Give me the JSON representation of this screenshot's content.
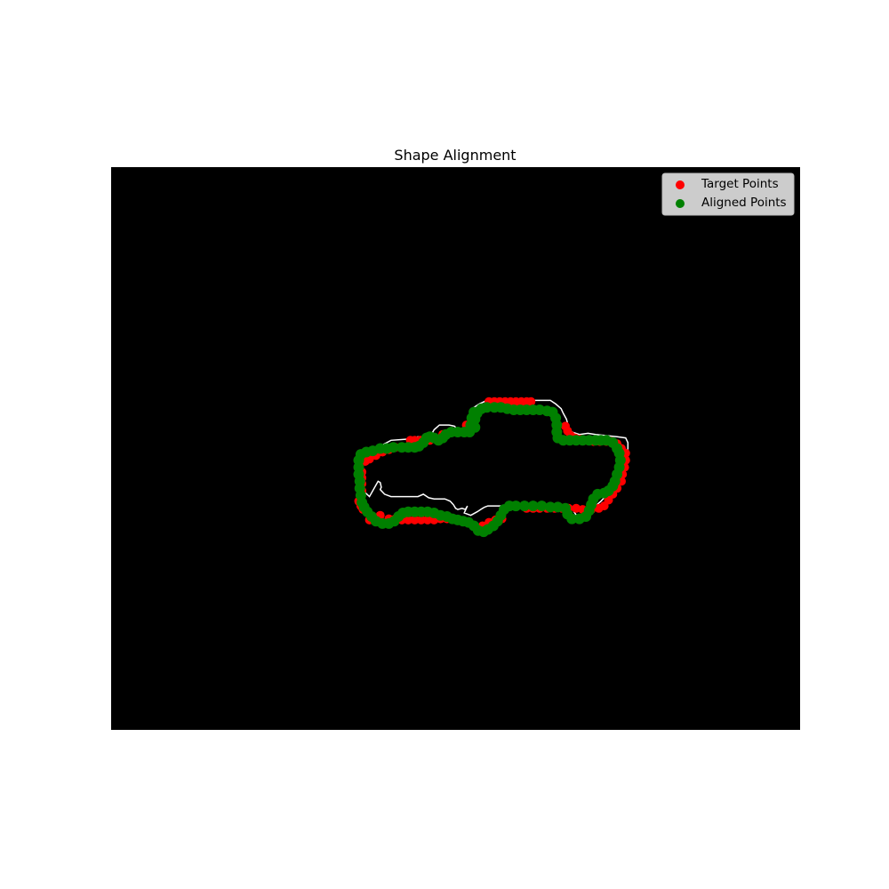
{
  "chart_data": {
    "type": "scatter",
    "title": "Shape Alignment",
    "xlabel": "",
    "ylabel": "",
    "axes_visible": false,
    "image_size": [
      640,
      480
    ],
    "background_color": "#000000",
    "contour_color": "#ffffff",
    "legend": {
      "placement": "top-right",
      "entries": [
        "Target Points",
        "Aligned Points"
      ]
    },
    "contour": [
      [
        248,
        268
      ],
      [
        250,
        269
      ],
      [
        251,
        273
      ],
      [
        250,
        275
      ],
      [
        254,
        279
      ],
      [
        260,
        281
      ],
      [
        285,
        281
      ],
      [
        290,
        279
      ],
      [
        295,
        282
      ],
      [
        300,
        283
      ],
      [
        310,
        283
      ],
      [
        315,
        285
      ],
      [
        318,
        288
      ],
      [
        320,
        291
      ],
      [
        322,
        292
      ],
      [
        326,
        291
      ],
      [
        329,
        292
      ],
      [
        331,
        289
      ],
      [
        328,
        295
      ],
      [
        334,
        297
      ],
      [
        340,
        294
      ],
      [
        345,
        291
      ],
      [
        347,
        290
      ],
      [
        350,
        289
      ],
      [
        360,
        289
      ],
      [
        390,
        289
      ],
      [
        400,
        289
      ],
      [
        410,
        289
      ],
      [
        420,
        289
      ],
      [
        425,
        289
      ],
      [
        428,
        290
      ],
      [
        430,
        294
      ],
      [
        433,
        298
      ],
      [
        436,
        299
      ],
      [
        440,
        299
      ],
      [
        443,
        297
      ],
      [
        445,
        294
      ],
      [
        447,
        291
      ],
      [
        450,
        289
      ],
      [
        455,
        285
      ],
      [
        458,
        282
      ],
      [
        462,
        279
      ],
      [
        468,
        274
      ],
      [
        472,
        268
      ],
      [
        474,
        262
      ],
      [
        476,
        255
      ],
      [
        478,
        248
      ],
      [
        480,
        240
      ],
      [
        480,
        235
      ],
      [
        478,
        231
      ],
      [
        470,
        230
      ],
      [
        460,
        229
      ],
      [
        450,
        228
      ],
      [
        443,
        227
      ],
      [
        435,
        228
      ],
      [
        428,
        226
      ],
      [
        425,
        222
      ],
      [
        423,
        215
      ],
      [
        420,
        210
      ],
      [
        418,
        206
      ],
      [
        413,
        202
      ],
      [
        408,
        199
      ],
      [
        400,
        199
      ],
      [
        380,
        199
      ],
      [
        360,
        199
      ],
      [
        349,
        199
      ],
      [
        342,
        202
      ],
      [
        337,
        205
      ],
      [
        333,
        211
      ],
      [
        333,
        220
      ],
      [
        331,
        224
      ],
      [
        328,
        225
      ],
      [
        323,
        225
      ],
      [
        319,
        221
      ],
      [
        314,
        220
      ],
      [
        305,
        220
      ],
      [
        300,
        224
      ],
      [
        297,
        229
      ],
      [
        293,
        230
      ],
      [
        285,
        230
      ],
      [
        281,
        232
      ],
      [
        275,
        232
      ],
      [
        260,
        233
      ],
      [
        252,
        237
      ],
      [
        245,
        240
      ],
      [
        238,
        245
      ],
      [
        233,
        248
      ],
      [
        230,
        253
      ],
      [
        230,
        258
      ],
      [
        230,
        263
      ],
      [
        231,
        268
      ],
      [
        233,
        275
      ],
      [
        240,
        281
      ]
    ],
    "series": [
      {
        "name": "Target Points",
        "color": "#ff0000",
        "points": [
          [
            351,
            200
          ],
          [
            356,
            200
          ],
          [
            361,
            200
          ],
          [
            366,
            200
          ],
          [
            371,
            200
          ],
          [
            376,
            200
          ],
          [
            381,
            200
          ],
          [
            386,
            200
          ],
          [
            390,
            200
          ],
          [
            278,
            233
          ],
          [
            282,
            233
          ],
          [
            287,
            233
          ],
          [
            291,
            233
          ],
          [
            296,
            233
          ],
          [
            308,
            228
          ],
          [
            264,
            239
          ],
          [
            258,
            241
          ],
          [
            252,
            243
          ],
          [
            246,
            246
          ],
          [
            240,
            249
          ],
          [
            236,
            251
          ],
          [
            330,
            220
          ],
          [
            331,
            224
          ],
          [
            422,
            221
          ],
          [
            424,
            225
          ],
          [
            427,
            229
          ],
          [
            431,
            231
          ],
          [
            436,
            232
          ],
          [
            442,
            233
          ],
          [
            448,
            234
          ],
          [
            454,
            234
          ],
          [
            460,
            234
          ],
          [
            465,
            234
          ],
          [
            470,
            236
          ],
          [
            474,
            240
          ],
          [
            478,
            244
          ],
          [
            478,
            250
          ],
          [
            477,
            256
          ],
          [
            475,
            262
          ],
          [
            474,
            268
          ],
          [
            470,
            274
          ],
          [
            466,
            279
          ],
          [
            462,
            284
          ],
          [
            458,
            289
          ],
          [
            453,
            291
          ],
          [
            446,
            292
          ],
          [
            438,
            292
          ],
          [
            432,
            291
          ],
          [
            425,
            291
          ],
          [
            419,
            291
          ],
          [
            412,
            291
          ],
          [
            405,
            291
          ],
          [
            398,
            291
          ],
          [
            392,
            291
          ],
          [
            386,
            291
          ],
          [
            345,
            306
          ],
          [
            351,
            303
          ],
          [
            357,
            301
          ],
          [
            363,
            300
          ],
          [
            312,
            300
          ],
          [
            306,
            300
          ],
          [
            300,
            301
          ],
          [
            294,
            301
          ],
          [
            288,
            301
          ],
          [
            282,
            301
          ],
          [
            276,
            301
          ],
          [
            270,
            301
          ],
          [
            264,
            300
          ],
          [
            258,
            300
          ],
          [
            250,
            297
          ],
          [
            244,
            299
          ],
          [
            240,
            301
          ],
          [
            234,
            292
          ],
          [
            232,
            289
          ],
          [
            230,
            285
          ],
          [
            233,
            260
          ],
          [
            233,
            265
          ],
          [
            233,
            270
          ],
          [
            233,
            276
          ]
        ]
      },
      {
        "name": "Aligned Points",
        "color": "#008000",
        "points": [
          [
            338,
            222
          ],
          [
            338,
            215
          ],
          [
            340,
            210
          ],
          [
            344,
            206
          ],
          [
            349,
            205
          ],
          [
            356,
            205
          ],
          [
            362,
            205
          ],
          [
            368,
            206
          ],
          [
            374,
            207
          ],
          [
            380,
            207
          ],
          [
            386,
            207
          ],
          [
            392,
            207
          ],
          [
            398,
            207
          ],
          [
            405,
            208
          ],
          [
            410,
            209
          ],
          [
            413,
            214
          ],
          [
            414,
            220
          ],
          [
            414,
            226
          ],
          [
            415,
            231
          ],
          [
            420,
            233
          ],
          [
            426,
            233
          ],
          [
            432,
            233
          ],
          [
            438,
            233
          ],
          [
            444,
            233
          ],
          [
            450,
            233
          ],
          [
            455,
            233
          ],
          [
            460,
            233
          ],
          [
            466,
            235
          ],
          [
            470,
            240
          ],
          [
            472,
            244
          ],
          [
            473,
            250
          ],
          [
            472,
            256
          ],
          [
            470,
            262
          ],
          [
            468,
            268
          ],
          [
            466,
            272
          ],
          [
            462,
            276
          ],
          [
            458,
            278
          ],
          [
            452,
            279
          ],
          [
            448,
            283
          ],
          [
            446,
            288
          ],
          [
            444,
            293
          ],
          [
            441,
            298
          ],
          [
            435,
            300
          ],
          [
            428,
            300
          ],
          [
            424,
            296
          ],
          [
            422,
            291
          ],
          [
            415,
            290
          ],
          [
            408,
            290
          ],
          [
            400,
            289
          ],
          [
            392,
            289
          ],
          [
            384,
            289
          ],
          [
            376,
            289
          ],
          [
            370,
            289
          ],
          [
            365,
            292
          ],
          [
            362,
            297
          ],
          [
            359,
            302
          ],
          [
            355,
            306
          ],
          [
            350,
            309
          ],
          [
            346,
            311
          ],
          [
            341,
            310
          ],
          [
            337,
            306
          ],
          [
            332,
            303
          ],
          [
            327,
            302
          ],
          [
            322,
            301
          ],
          [
            317,
            300
          ],
          [
            312,
            298
          ],
          [
            306,
            297
          ],
          [
            300,
            295
          ],
          [
            294,
            294
          ],
          [
            288,
            294
          ],
          [
            282,
            294
          ],
          [
            276,
            294
          ],
          [
            271,
            295
          ],
          [
            267,
            298
          ],
          [
            263,
            302
          ],
          [
            258,
            304
          ],
          [
            252,
            304
          ],
          [
            246,
            302
          ],
          [
            242,
            298
          ],
          [
            238,
            294
          ],
          [
            235,
            290
          ],
          [
            233,
            286
          ],
          [
            232,
            280
          ],
          [
            231,
            274
          ],
          [
            231,
            268
          ],
          [
            230,
            262
          ],
          [
            230,
            256
          ],
          [
            230,
            250
          ],
          [
            232,
            245
          ],
          [
            237,
            243
          ],
          [
            243,
            242
          ],
          [
            250,
            240
          ],
          [
            256,
            240
          ],
          [
            262,
            239
          ],
          [
            270,
            239
          ],
          [
            276,
            239
          ],
          [
            282,
            239
          ],
          [
            286,
            238
          ],
          [
            290,
            235
          ],
          [
            293,
            231
          ],
          [
            296,
            230
          ],
          [
            300,
            231
          ],
          [
            304,
            233
          ],
          [
            308,
            231
          ],
          [
            311,
            228
          ],
          [
            316,
            226
          ],
          [
            322,
            226
          ],
          [
            328,
            226
          ],
          [
            333,
            226
          ],
          [
            334,
            220
          ],
          [
            335,
            214
          ],
          [
            337,
            209
          ]
        ]
      }
    ]
  }
}
